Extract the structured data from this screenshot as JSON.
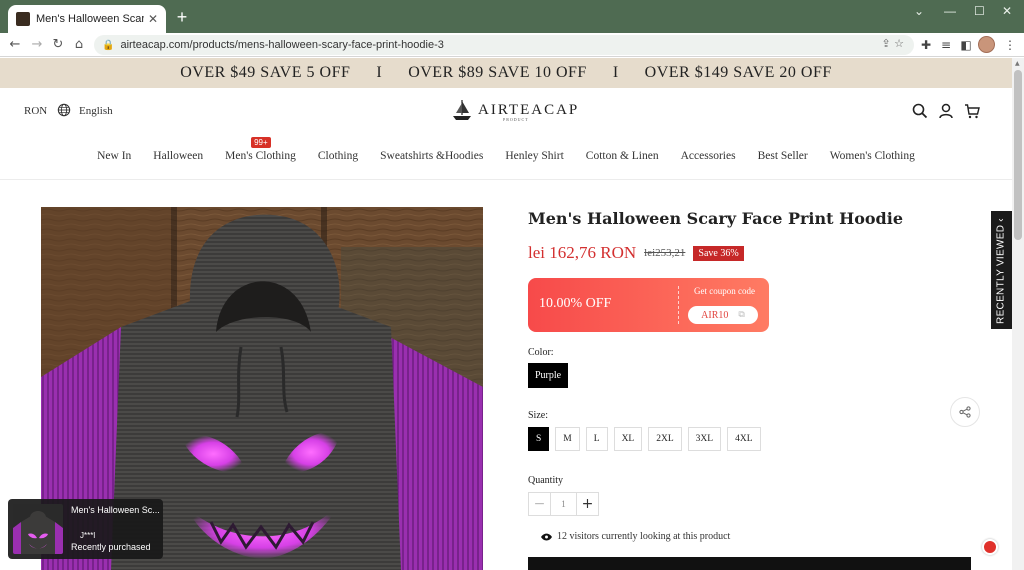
{
  "browser": {
    "tab_title": "Men's Halloween Scary Face Prin",
    "url": "airteacap.com/products/mens-halloween-scary-face-print-hoodie-3"
  },
  "promo": {
    "offers": [
      "OVER $49 SAVE 5 OFF",
      "OVER $89 SAVE 10 OFF",
      "OVER $149 SAVE 20 OFF"
    ],
    "separator": "I"
  },
  "header": {
    "currency": "RON",
    "language": "English",
    "logo_text": "AIRTEACAP",
    "logo_sub": "PRODUCT"
  },
  "menu": {
    "items": [
      "New In",
      "Halloween",
      "Men's Clothing",
      "Clothing",
      "Sweatshirts &Hoodies",
      "Henley Shirt",
      "Cotton & Linen",
      "Accessories",
      "Best Seller",
      "Women's Clothing"
    ],
    "badge": "99+"
  },
  "product": {
    "title": "Men's Halloween Scary Face Print Hoodie",
    "price": "lei 162,76 RON",
    "original_price": "lei253,21",
    "save": "Save 36%"
  },
  "coupon": {
    "discount": "10.00% OFF",
    "get_label": "Get coupon code",
    "code": "AIR10"
  },
  "options": {
    "color_label": "Color:",
    "color_value": "Purple",
    "size_label": "Size:",
    "sizes": [
      "S",
      "M",
      "L",
      "XL",
      "2XL",
      "3XL",
      "4XL"
    ],
    "selected_size": "S",
    "quantity_label": "Quantity",
    "quantity": "1"
  },
  "visitors": "12 visitors currently looking at this product",
  "recently_viewed": "RECENTLY VIEWED",
  "toast": {
    "product": "Men's Halloween Sc...",
    "user": "J***l",
    "status": "Recently purchased"
  }
}
